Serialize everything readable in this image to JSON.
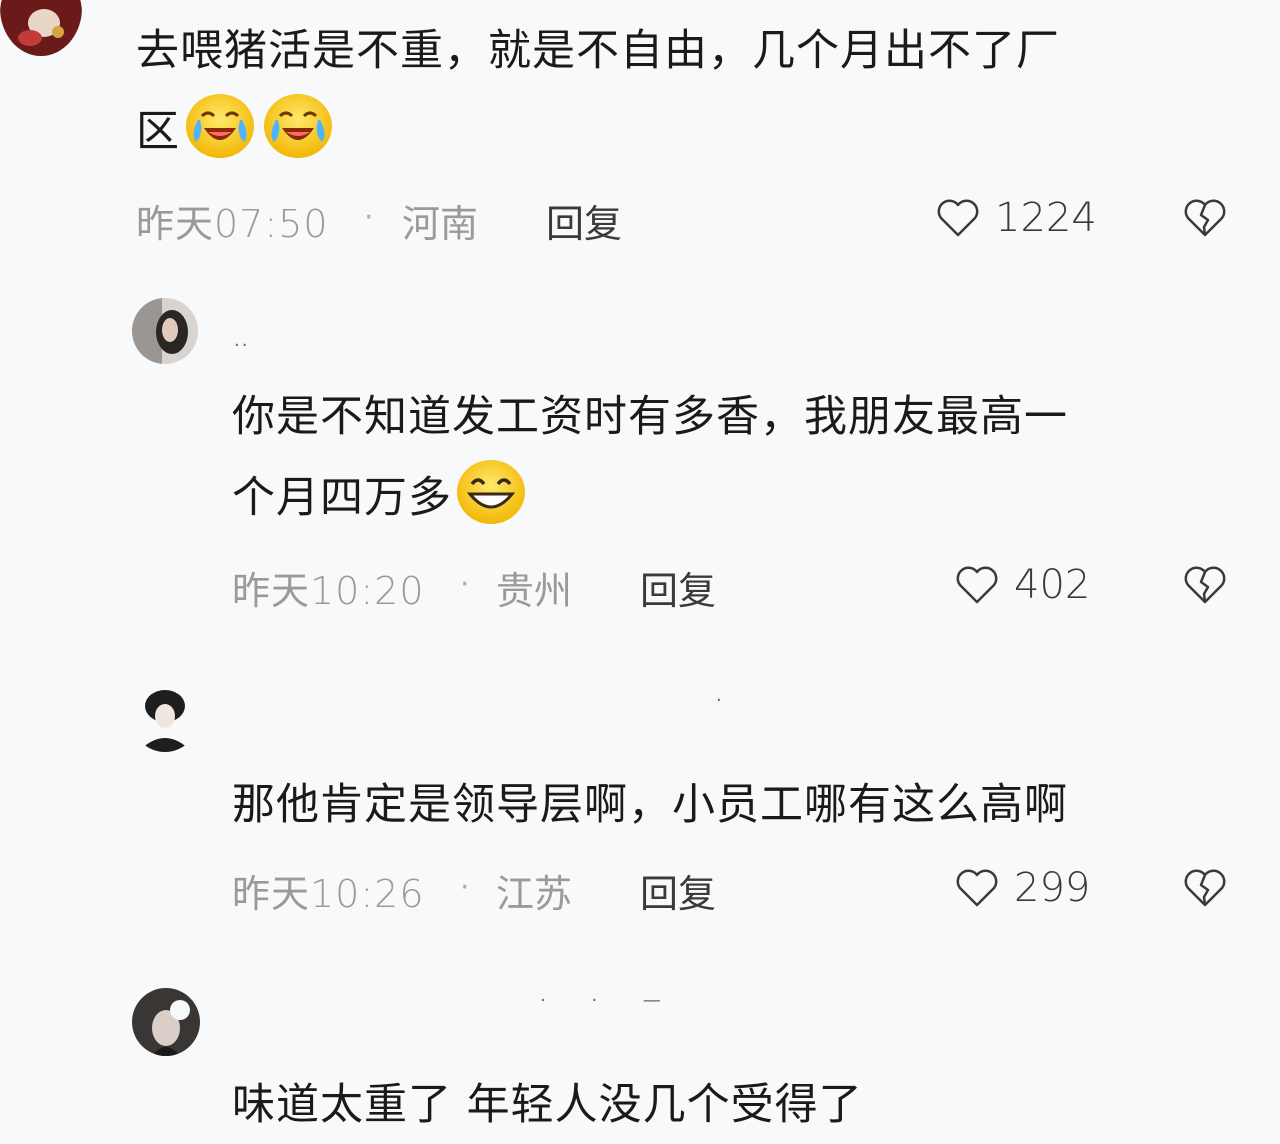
{
  "comments": [
    {
      "text_line1": "去喂猪活是不重，就是不自由，几个月出不了厂",
      "text_line2": "区",
      "emojis": [
        "crying-laughing-emoji",
        "crying-laughing-emoji"
      ],
      "time": "昨天07:50",
      "separator": "·",
      "location": "河南",
      "reply_label": "回复",
      "likes": "1224"
    },
    {
      "username": "..",
      "text_line1": "你是不知道发工资时有多香，我朋友最高一",
      "text_line2": "个月四万多",
      "emojis": [
        "grinning-emoji"
      ],
      "time": "昨天10:20",
      "separator": "·",
      "location": "贵州",
      "reply_label": "回复",
      "likes": "402"
    },
    {
      "username": "·",
      "text_line1": "那他肯定是领导层啊，小员工哪有这么高啊",
      "time": "昨天10:26",
      "separator": "·",
      "location": "江苏",
      "reply_label": "回复",
      "likes": "299"
    },
    {
      "username": "· · —",
      "text_line1": "味道太重了 年轻人没几个受得了"
    }
  ],
  "colors": {
    "background": "#f8f9fa",
    "text": "#1a1a1a",
    "meta": "#9a9a9a",
    "reply": "#3a3a3a",
    "emoji_yellow": "#f5c518"
  }
}
